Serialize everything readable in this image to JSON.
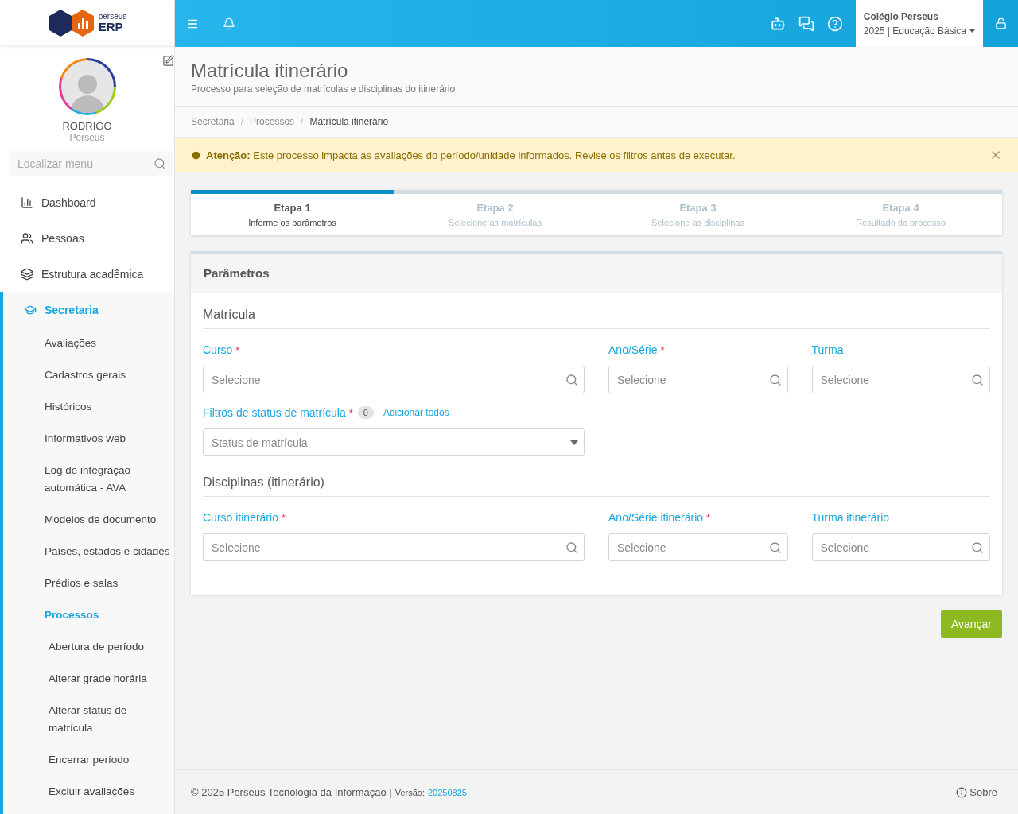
{
  "logo": {
    "small": "perseus",
    "large": "ERP"
  },
  "topbar": {
    "institution": "Colégio Perseus",
    "period": "2025 | Educação Básica"
  },
  "user": {
    "name": "RODRIGO",
    "org": "Perseus"
  },
  "sidebar": {
    "search_placeholder": "Localizar menu",
    "items": [
      {
        "label": "Dashboard",
        "selected": false
      },
      {
        "label": "Pessoas",
        "selected": false
      },
      {
        "label": "Estrutura acadêmica",
        "selected": false
      },
      {
        "label": "Secretaria",
        "selected": true,
        "expanded": true,
        "children": [
          {
            "label": "Avaliações",
            "selected": false
          },
          {
            "label": "Cadastros gerais",
            "selected": false
          },
          {
            "label": "Históricos",
            "selected": false
          },
          {
            "label": "Informativos web",
            "selected": false
          },
          {
            "label": "Log de integração automática - AVA",
            "selected": false
          },
          {
            "label": "Modelos de documento",
            "selected": false
          },
          {
            "label": "Países, estados e cidades",
            "selected": false
          },
          {
            "label": "Prédios e salas",
            "selected": false
          },
          {
            "label": "Processos",
            "selected": true,
            "children": [
              {
                "label": "Abertura de período",
                "selected": false
              },
              {
                "label": "Alterar grade horária",
                "selected": false
              },
              {
                "label": "Alterar status de matrícula",
                "selected": false
              },
              {
                "label": "Encerrar período",
                "selected": false
              },
              {
                "label": "Excluir avaliações",
                "selected": false
              }
            ]
          }
        ]
      }
    ]
  },
  "page": {
    "title": "Matrícula itinerário",
    "subtitle": "Processo para seleção de matrículas e disciplinas do itinerário"
  },
  "breadcrumb": {
    "separator": "/",
    "items": [
      "Secretaria",
      "Processos",
      "Matrícula itinerário"
    ]
  },
  "alert": {
    "text": "**Atenção:** Este processo impacta as avaliações do período/unidade informados. Revise os filtros antes de executar."
  },
  "steps": {
    "level": 0.25,
    "items": [
      {
        "title": "Etapa 1",
        "subtitle": "Informe os parâmetros",
        "selected": true
      },
      {
        "title": "Etapa 2",
        "subtitle": "Selecione as matrículas",
        "selected": false
      },
      {
        "title": "Etapa 3",
        "subtitle": "Selecione as disciplinas",
        "selected": false
      },
      {
        "title": "Etapa 4",
        "subtitle": "Resultado do processo",
        "selected": false
      }
    ]
  },
  "panel": {
    "title": "Parâmetros",
    "required_mark": "*",
    "sections": [
      {
        "title": "Matrícula",
        "fields": [
          {
            "kind": "search",
            "label": "Curso",
            "required": true,
            "placeholder": "Selecione"
          },
          {
            "kind": "search",
            "label": "Ano/Série",
            "required": true,
            "placeholder": "Selecione"
          },
          {
            "kind": "search",
            "label": "Turma",
            "required": false,
            "placeholder": "Selecione"
          },
          {
            "kind": "select",
            "label": "Filtros de status de matrícula",
            "required": true,
            "count": "0",
            "link": "Adicionar todos",
            "placeholder": "Status de matrícula"
          }
        ]
      },
      {
        "title": "Disciplinas (itinerário)",
        "fields": [
          {
            "kind": "search",
            "label": "Curso itinerário",
            "required": true,
            "placeholder": "Selecione"
          },
          {
            "kind": "search",
            "label": "Ano/Série itinerário",
            "required": true,
            "placeholder": "Selecione"
          },
          {
            "kind": "search",
            "label": "Turma itinerário",
            "required": false,
            "placeholder": "Selecione"
          }
        ]
      }
    ]
  },
  "next_button": "Avançar",
  "footer": {
    "copyright": "© 2025 Perseus Tecnologia da Informação |",
    "version_label": "Versão:",
    "version": "20250825",
    "about": "Sobre"
  }
}
